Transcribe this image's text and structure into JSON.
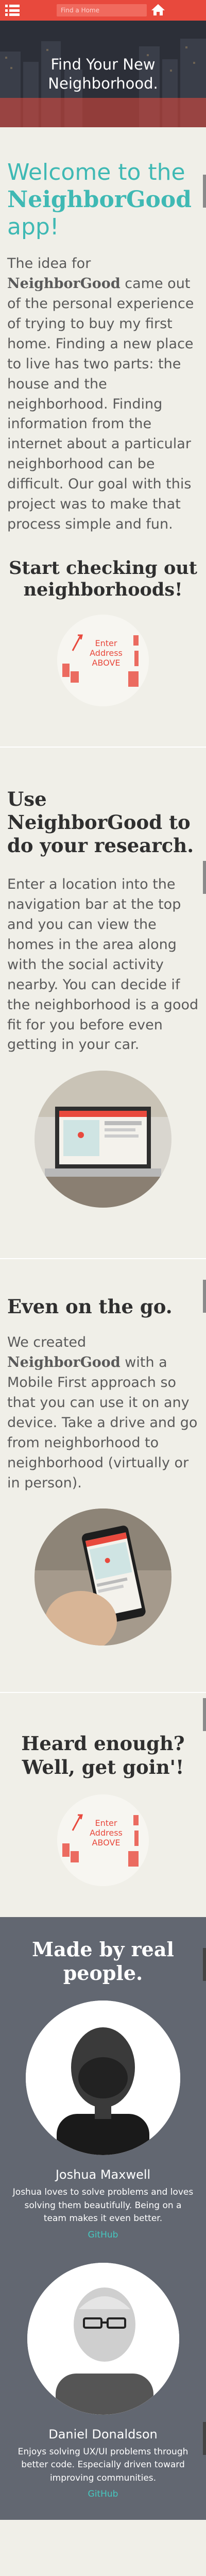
{
  "nav": {
    "search_placeholder": "Find a Home",
    "menu_icon": "list-icon",
    "home_icon": "home-icon"
  },
  "hero": {
    "title_line1": "Find Your New",
    "title_line2": "Neighborhood."
  },
  "welcome": {
    "title_prefix": "Welcome to the",
    "title_brand": "NeighborGood",
    "title_suffix": "app!",
    "intro_lead": "The idea for",
    "intro_brand": "NeighborGood",
    "intro_rest": "came out of the personal experience of trying to buy my first home. Finding a new place to live has two parts: the house and the neighborhood. Finding information from the internet about a particular neighborhood can be difficult. Our goal with this project was to make that process simple and fun.",
    "cta_title": "Start checking out neighborhoods!",
    "address_hint": "Enter Address ABOVE"
  },
  "research": {
    "title": "Use NeighborGood to do your research.",
    "body": "Enter a location into the navigation bar at the top and you can view the homes in the area along with the social activity nearby. You can decide if the neighborhood is a good fit for you before even getting in your car."
  },
  "mobile": {
    "title": "Even on the go.",
    "body_lead": "We created",
    "body_brand": "NeighborGood",
    "body_rest": "with a Mobile First approach so that you can use it on any device. Take a drive and go from neighborhood to neighborhood (virtually or in person)."
  },
  "heard": {
    "title": "Heard enough? Well, get goin'!",
    "address_hint": "Enter Address ABOVE"
  },
  "team": {
    "title": "Made by real people.",
    "members": [
      {
        "name": "Joshua Maxwell",
        "bio": "Joshua loves to solve problems and loves solving them beautifully. Being on a team makes it even better.",
        "link": "GitHub"
      },
      {
        "name": "Daniel Donaldson",
        "bio": "Enjoys solving UX/UI problems through better code. Especially driven toward improving communities.",
        "link": "GitHub"
      }
    ]
  },
  "colors": {
    "brand_red": "#e8493d",
    "teal": "#3fb9b4",
    "team_bg": "#626771",
    "page_bg": "#f0efe8"
  }
}
